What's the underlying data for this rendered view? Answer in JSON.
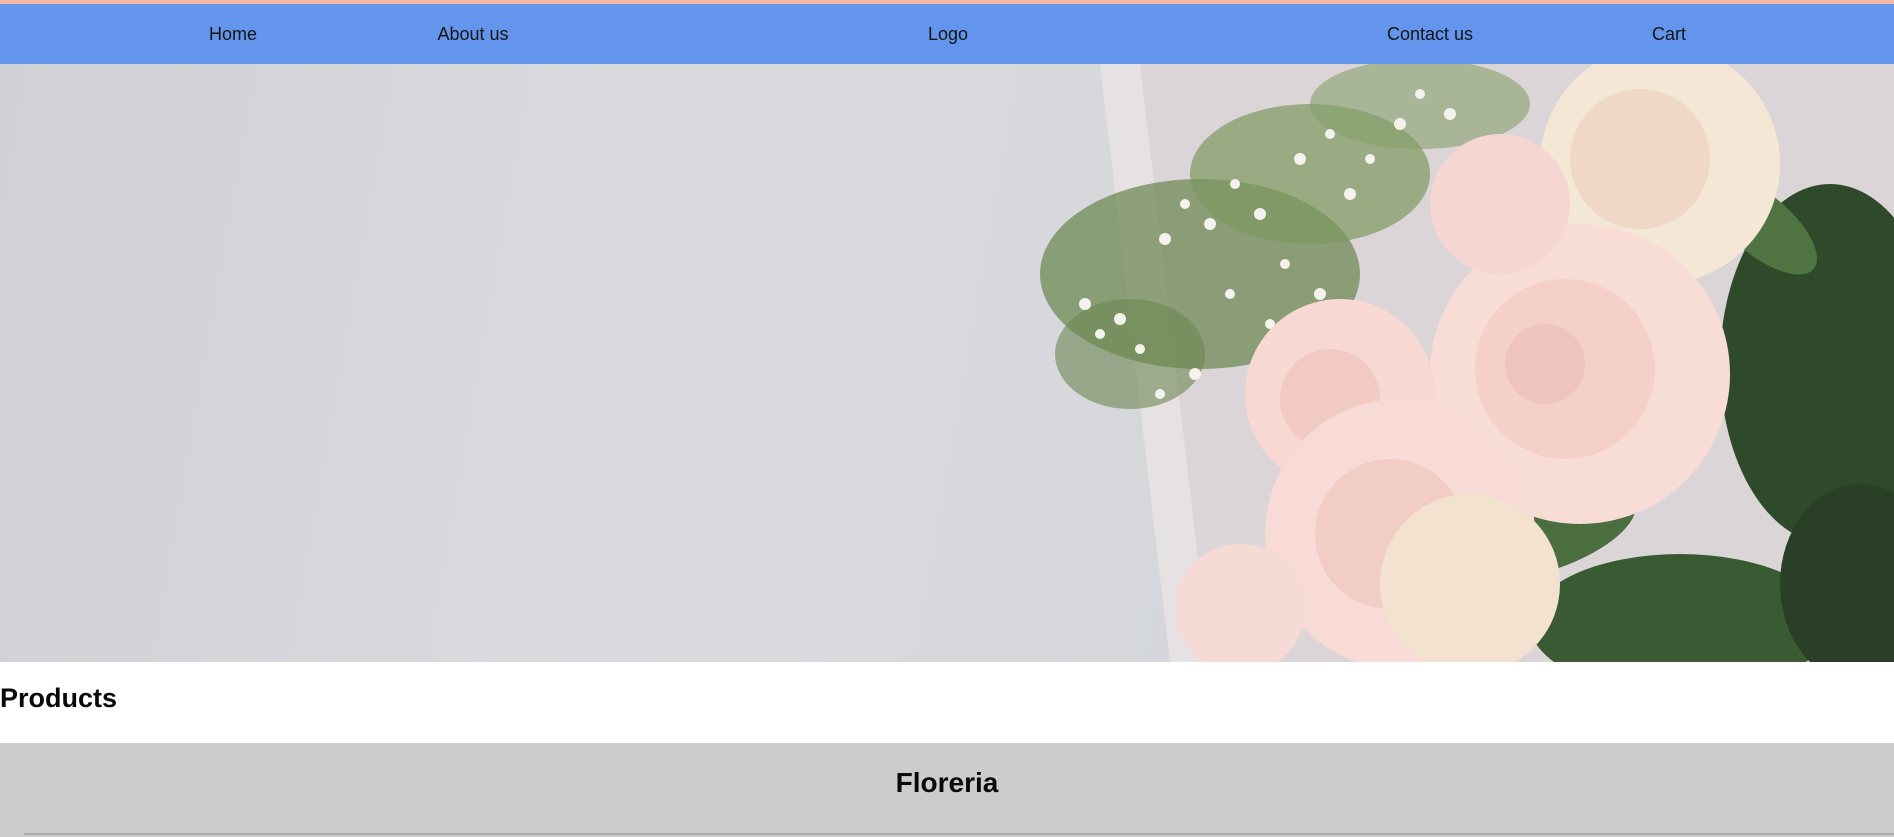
{
  "nav": {
    "home": "Home",
    "about": "About us",
    "logo": "Logo",
    "contact": "Contact us",
    "cart": "Cart"
  },
  "hero": {
    "image": "roses-bouquet-photo"
  },
  "products": {
    "heading": "Products"
  },
  "footer": {
    "title": "Floreria"
  },
  "colors": {
    "navbar": "#6495ed",
    "top_strip": "#f4b7a3",
    "footer_band": "#cccccc",
    "background": "#ffffff"
  }
}
